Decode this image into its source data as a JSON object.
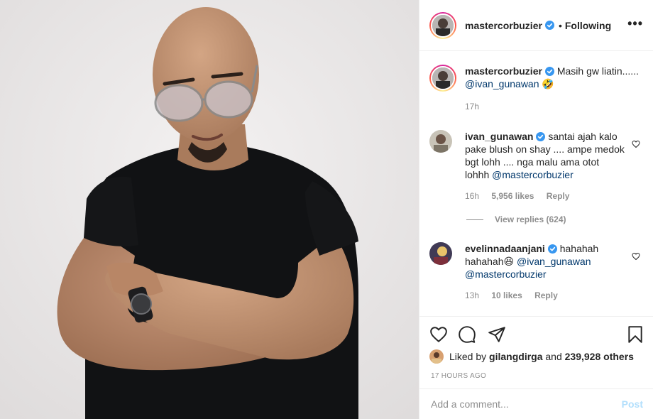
{
  "post_author": {
    "username": "mastercorbuzier",
    "follow_status": "Following",
    "separator": "•"
  },
  "caption": {
    "username": "mastercorbuzier",
    "text": "Masih gw liatin......",
    "mention": "@ivan_gunawan",
    "emoji": "🤣",
    "time": "17h"
  },
  "comments": [
    {
      "username": "ivan_gunawan",
      "text": "santai ajah kalo pake blush on shay .... ampe medok bgt lohh .... nga malu ama otot lohhh",
      "mention": "@mastercorbuzier",
      "time": "16h",
      "likes": "5,956 likes",
      "reply": "Reply",
      "view_replies": "View replies (624)"
    },
    {
      "username": "evelinnadaanjani",
      "text": "hahahah hahahah😆",
      "mention1": "@ivan_gunawan",
      "mention2": "@mastercorbuzier",
      "time": "13h",
      "likes": "10 likes",
      "reply": "Reply"
    }
  ],
  "likes": {
    "prefix": "Liked by",
    "user": "gilangdirga",
    "and": "and",
    "others": "239,928 others"
  },
  "timestamp": "17 HOURS AGO",
  "add_comment": {
    "placeholder": "Add a comment...",
    "post_label": "Post"
  },
  "colors": {
    "verified_blue": "#3897f0",
    "mention_blue": "#00376b",
    "muted_gray": "#8e8e8e",
    "post_button_disabled": "#b2dffc",
    "photo_background": "#eceaea"
  }
}
